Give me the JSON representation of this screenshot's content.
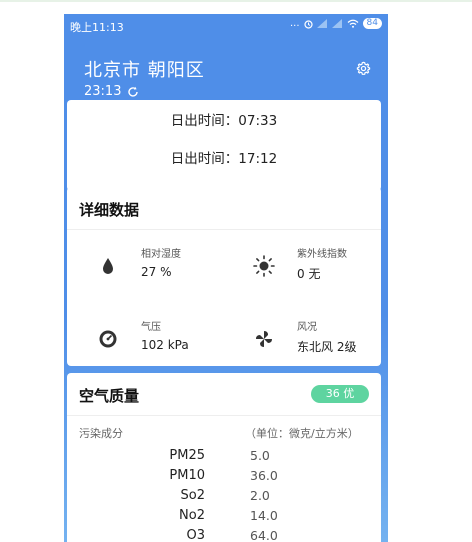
{
  "status_bar": {
    "time": "晚上11:13",
    "signal_text": "...",
    "battery": "84"
  },
  "header": {
    "city": "北京市 朝阳区",
    "update_time": "23:13"
  },
  "sun": {
    "sunrise": "日出时间：07:33",
    "sunset": "日出时间：17:12"
  },
  "detail": {
    "title": "详细数据",
    "items": [
      {
        "label": "相对湿度",
        "value": "27 %",
        "icon": "humidity-drop-icon"
      },
      {
        "label": "紫外线指数",
        "value": "0 无",
        "icon": "sun-icon"
      },
      {
        "label": "气压",
        "value": "102 kPa",
        "icon": "pressure-gauge-icon"
      },
      {
        "label": "风况",
        "value": "东北风 2级",
        "icon": "wind-fan-icon"
      }
    ]
  },
  "air_quality": {
    "title": "空气质量",
    "badge": "36 优",
    "pollutant_header": "污染成分",
    "unit_header": "（单位：微克/立方米）",
    "pollutants": [
      {
        "name": "PM25",
        "value": "5.0"
      },
      {
        "name": "PM10",
        "value": "36.0"
      },
      {
        "name": "So2",
        "value": "2.0"
      },
      {
        "name": "No2",
        "value": "14.0"
      },
      {
        "name": "O3",
        "value": "64.0"
      }
    ]
  },
  "colors": {
    "header_blue": "#4f8ee8",
    "badge_green": "#5ed4a0"
  }
}
